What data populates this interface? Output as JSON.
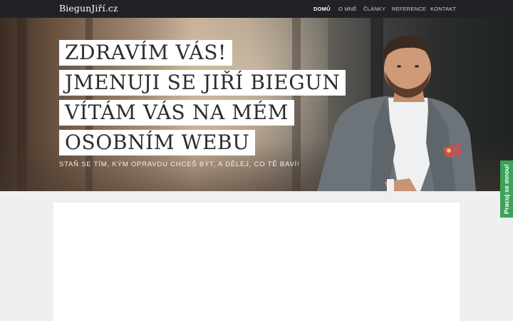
{
  "brand": "BiegunJiří.cz",
  "nav": [
    {
      "label": "DOMŮ",
      "active": true
    },
    {
      "label": "O MNĚ",
      "active": false
    },
    {
      "label": "ČLÁNKY",
      "active": false
    },
    {
      "label": "REFERENCE",
      "active": false
    },
    {
      "label": "KONTAKT",
      "active": false
    }
  ],
  "hero": {
    "lines": [
      "ZDRAVÍM VÁS!",
      "JMENUJI SE JIŘÍ BIEGUN",
      "VÍTÁM VÁS NA MÉM",
      "OSOBNÍM WEBU"
    ],
    "subtitle": "STAŇ SE TÍM, KÝM OPRAVDU CHCEŠ BÝT, A DĚLEJ, CO TĚ BAVÍ!"
  },
  "side_tab": {
    "label": "Pracuj se mnou!",
    "color": "#3aa357"
  },
  "colors": {
    "navbar": "#212226",
    "page_bg": "#eeeff1",
    "card_bg": "#ffffff"
  }
}
